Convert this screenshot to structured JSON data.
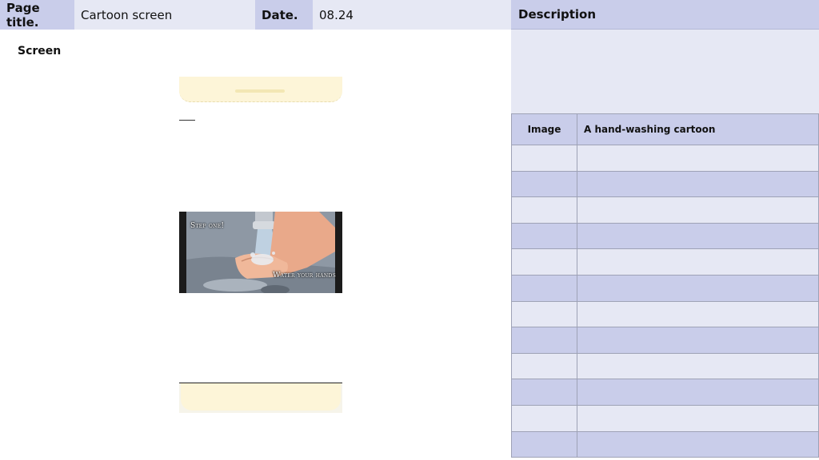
{
  "header": {
    "page_title_label": "Page title.",
    "page_title_value": "Cartoon screen",
    "date_label": "Date.",
    "date_value": "08.24"
  },
  "screen": {
    "label": "Screen",
    "video": {
      "caption_top": "Step one!",
      "caption_bottom": "Water your hands"
    }
  },
  "description": {
    "title": "Description",
    "table": {
      "head": [
        "Image",
        "A hand-washing cartoon"
      ],
      "empty_rows": 12
    }
  },
  "colors": {
    "header_dark": "#c9cdea",
    "header_light": "#e6e8f4",
    "phone_cream": "#fdf5d8"
  }
}
